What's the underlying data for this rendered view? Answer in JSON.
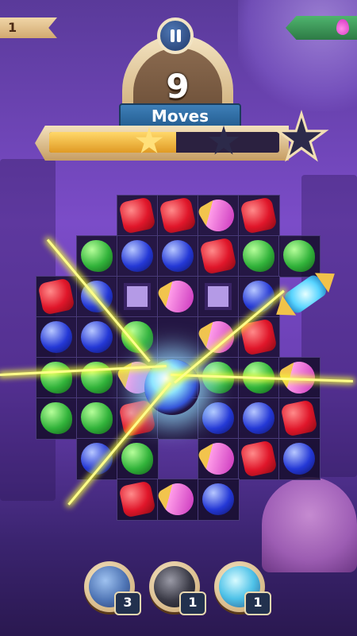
{
  "level_ribbon": {
    "value": "1"
  },
  "moves": {
    "count": "9",
    "label": "Moves"
  },
  "progress": {
    "fraction": 0.55,
    "stars_earned": 1,
    "stars_total": 3
  },
  "board": {
    "rows": [
      [
        "",
        "",
        "red",
        "red",
        "potion",
        "red",
        "",
        ""
      ],
      [
        "",
        "green",
        "blue",
        "blue",
        "red",
        "green",
        "green",
        ""
      ],
      [
        "red",
        "blue",
        "blocked",
        "potion",
        "blocked",
        "blue",
        "",
        ""
      ],
      [
        "blue",
        "blue",
        "green",
        "",
        "potion",
        "red",
        "",
        ""
      ],
      [
        "green",
        "green",
        "potion",
        "",
        "green",
        "green",
        "potion",
        ""
      ],
      [
        "green",
        "green",
        "red",
        "",
        "blue",
        "blue",
        "red",
        ""
      ],
      [
        "",
        "blue",
        "green",
        "",
        "potion",
        "red",
        "blue",
        ""
      ],
      [
        "",
        "",
        "red",
        "potion",
        "blue",
        "",
        "",
        ""
      ]
    ]
  },
  "boosters": [
    {
      "name": "hammer",
      "count": "3"
    },
    {
      "name": "bomb",
      "count": "1"
    },
    {
      "name": "rocket",
      "count": "1"
    }
  ],
  "colors": {
    "accent": "#3e7fb8",
    "progress_fill": "#ffd86a",
    "board_border": "#9b7fd1"
  }
}
